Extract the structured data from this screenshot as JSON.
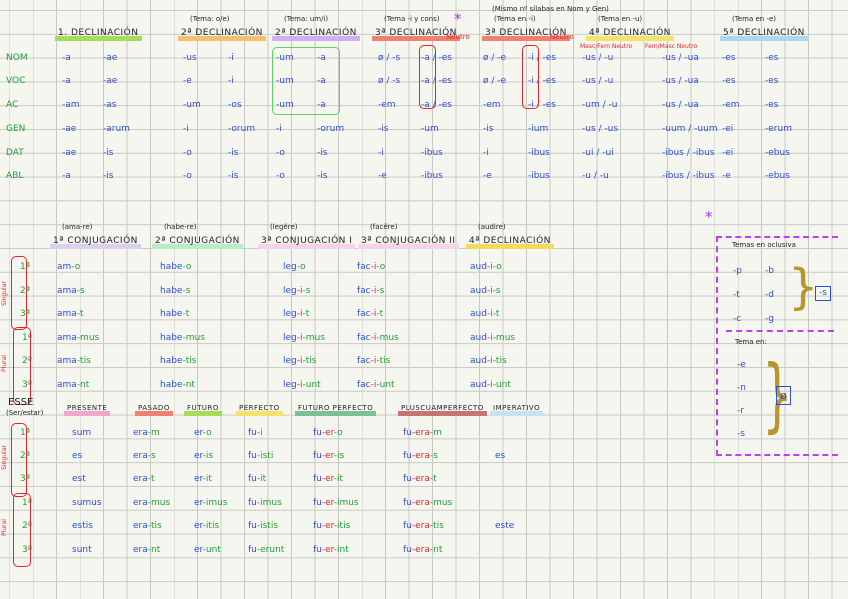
{
  "declensions": {
    "cases": [
      "NOM",
      "VOC",
      "AC",
      "GEN",
      "DAT",
      "ABL"
    ],
    "groups": [
      {
        "note": "",
        "title": "1. Declinación",
        "color": "#a5dc5a",
        "forms": [
          [
            "-a",
            "-ae"
          ],
          [
            "-a",
            "-ae"
          ],
          [
            "-am",
            "-as"
          ],
          [
            "-ae",
            "-arum"
          ],
          [
            "-ae",
            "-is"
          ],
          [
            "-a",
            "-is"
          ]
        ]
      },
      {
        "note": "(Tema: o/e)",
        "title": "2ª Declinación",
        "color": "#f5bf70",
        "forms": [
          [
            "-us",
            "-i"
          ],
          [
            "-e",
            "-i"
          ],
          [
            "-um",
            "-os"
          ],
          [
            "-i",
            "-orum"
          ],
          [
            "-o",
            "-is"
          ],
          [
            "-o",
            "-is"
          ]
        ]
      },
      {
        "note": "(Tema: um/i)",
        "title": "2ª Declinación",
        "color": "#cfaef2",
        "forms": [
          [
            "-um",
            "-a"
          ],
          [
            "-um",
            "-a"
          ],
          [
            "-um",
            "-a"
          ],
          [
            "-i",
            "-orum"
          ],
          [
            "-o",
            "-is"
          ],
          [
            "-o",
            "-is"
          ]
        ]
      },
      {
        "note": "(Tema -i y cons)",
        "title": "3ª Declinación",
        "color": "#ef8170",
        "forms": [
          [
            "ø / -s",
            "-a / -es"
          ],
          [
            "ø / -s",
            "-a / -es"
          ],
          [
            "-em",
            "-a / -es"
          ],
          [
            "-is",
            "-um"
          ],
          [
            "-i",
            "-ibus"
          ],
          [
            "-e",
            "-ibus"
          ]
        ]
      },
      {
        "note": "(Tema en -i)",
        "title": "3ª Declinación",
        "color": "#ef8170",
        "forms": [
          [
            "ø / -e",
            "-i / -es"
          ],
          [
            "ø / -e",
            "-i / -es"
          ],
          [
            "-em",
            "-i / -es"
          ],
          [
            "-is",
            "-ium"
          ],
          [
            "-i",
            "-ibus"
          ],
          [
            "-e",
            "-ibus"
          ]
        ]
      },
      {
        "note": "(Tema en -u)",
        "title": "4ª Declinación",
        "color": "#f3e36a",
        "forms": [
          [
            "-us / -u",
            "-us / -ua"
          ],
          [
            "-us / -u",
            "-us / -ua"
          ],
          [
            "-um / -u",
            "-us / -ua"
          ],
          [
            "-us / -us",
            "-uum / -uum"
          ],
          [
            "-ui / -ui",
            "-ibus / -ibus"
          ],
          [
            "-u / -u",
            "-ibus / -ibus"
          ]
        ]
      },
      {
        "note": "(Tema en -e)",
        "title": "5ª Declinación",
        "color": "#a9d8f0",
        "forms": [
          [
            "-es",
            "-es"
          ],
          [
            "-es",
            "-es"
          ],
          [
            "-em",
            "-es"
          ],
          [
            "-ei",
            "-erum"
          ],
          [
            "-ei",
            "-ebus"
          ],
          [
            "-e",
            "-ebus"
          ]
        ]
      }
    ],
    "annotations": {
      "neutro": "Neutro",
      "extra_note": "(Mismo nº sílabas en Nom y Gen)",
      "masc_fem_neutro": "Masc/Fem Neutro",
      "fem_masc_neutro": "Fem/Masc Neutro",
      "asterisk": "*"
    }
  },
  "conjugations": {
    "persons": [
      "1ª",
      "2ª",
      "3ª",
      "1ª",
      "2ª",
      "3ª"
    ],
    "singular_label": "Singular",
    "plural_label": "Plural",
    "groups": [
      {
        "note": "(ama-re)",
        "title": "1ª Conjugación",
        "color": "#ddd0ee",
        "forms": [
          [
            "am",
            "",
            "-o"
          ],
          [
            "ama",
            "",
            "-s"
          ],
          [
            "ama",
            "",
            "-t"
          ],
          [
            "ama",
            "",
            "-mus"
          ],
          [
            "ama",
            "",
            "-tis"
          ],
          [
            "ama",
            "",
            "-nt"
          ]
        ]
      },
      {
        "note": "(habe-re)",
        "title": "2ª Conjugación",
        "color": "#b8ebc8",
        "forms": [
          [
            "habe",
            "",
            "-o"
          ],
          [
            "habe",
            "",
            "-s"
          ],
          [
            "habe",
            "",
            "-t"
          ],
          [
            "habe",
            "",
            "-mus"
          ],
          [
            "habe",
            "",
            "-tis"
          ],
          [
            "habe",
            "",
            "-nt"
          ]
        ]
      },
      {
        "note": "(legĕre)",
        "title": "3ª Conjugación I",
        "color": "#f6d3e6",
        "forms": [
          [
            "leg",
            "",
            "-o"
          ],
          [
            "leg",
            "-i",
            "-s"
          ],
          [
            "leg",
            "-i",
            "-t"
          ],
          [
            "leg",
            "-i",
            "-mus"
          ],
          [
            "leg",
            "-i",
            "-tis"
          ],
          [
            "leg",
            "-i",
            "-unt"
          ]
        ]
      },
      {
        "note": "(facĕre)",
        "title": "3ª Conjugación II",
        "color": "#f6d3e6",
        "forms": [
          [
            "fac",
            "-i",
            "-o"
          ],
          [
            "fac",
            "-i",
            "-s"
          ],
          [
            "fac",
            "-i",
            "-t"
          ],
          [
            "fac",
            "-i",
            "-mus"
          ],
          [
            "fac",
            "-i",
            "-tis"
          ],
          [
            "fac",
            "-i",
            "-unt"
          ]
        ]
      },
      {
        "note": "(audire)",
        "title": "4ª Declinación",
        "color": "#f3db5a",
        "forms": [
          [
            "aud",
            "-i",
            "-o"
          ],
          [
            "aud",
            "-i",
            "-s"
          ],
          [
            "aud",
            "-i",
            "-t"
          ],
          [
            "aud",
            "-i",
            "-mus"
          ],
          [
            "aud",
            "-i",
            "-tis"
          ],
          [
            "aud",
            "-i",
            "-unt"
          ]
        ]
      }
    ]
  },
  "esse": {
    "title": "ESSE",
    "subtitle": "(Ser/estar)",
    "tenses": [
      {
        "title": "Presente",
        "color": "#f0a6cf",
        "forms": [
          [
            "sum",
            "",
            ""
          ],
          [
            "es",
            "",
            ""
          ],
          [
            "est",
            "",
            ""
          ],
          [
            "sumus",
            "",
            ""
          ],
          [
            "estis",
            "",
            ""
          ],
          [
            "sunt",
            "",
            ""
          ]
        ]
      },
      {
        "title": "Pasado",
        "color": "#ef8170",
        "forms": [
          [
            "era",
            "",
            "-m"
          ],
          [
            "era",
            "",
            "-s"
          ],
          [
            "era",
            "",
            "-t"
          ],
          [
            "era",
            "",
            "-mus"
          ],
          [
            "era",
            "",
            "-tis"
          ],
          [
            "era",
            "",
            "-nt"
          ]
        ]
      },
      {
        "title": "Futuro",
        "color": "#a5dc5a",
        "forms": [
          [
            "er",
            "",
            "-o"
          ],
          [
            "er",
            "",
            "-is"
          ],
          [
            "er",
            "",
            "-it"
          ],
          [
            "er",
            "",
            "-imus"
          ],
          [
            "er",
            "",
            "-itis"
          ],
          [
            "er",
            "",
            "-unt"
          ]
        ]
      },
      {
        "title": "Perfecto",
        "color": "#f3e36a",
        "forms": [
          [
            "fu",
            "",
            "-i"
          ],
          [
            "fu",
            "",
            "-isti"
          ],
          [
            "fu",
            "",
            "-it"
          ],
          [
            "fu",
            "",
            "-imus"
          ],
          [
            "fu",
            "",
            "-istis"
          ],
          [
            "fu",
            "",
            "-erunt"
          ]
        ]
      },
      {
        "title": "Futuro perfecto",
        "color": "#7fbf95",
        "forms": [
          [
            "fu",
            "-er",
            "-o"
          ],
          [
            "fu",
            "-er",
            "-is"
          ],
          [
            "fu",
            "-er",
            "-it"
          ],
          [
            "fu",
            "-er",
            "-imus"
          ],
          [
            "fu",
            "-er",
            "-itis"
          ],
          [
            "fu",
            "-er",
            "-int"
          ]
        ]
      },
      {
        "title": "Pluscuamperfecto",
        "color": "#c77474",
        "forms": [
          [
            "fu",
            "-era",
            "-m"
          ],
          [
            "fu",
            "-era",
            "-s"
          ],
          [
            "fu",
            "-era",
            "-t"
          ],
          [
            "fu",
            "-era",
            "-mus"
          ],
          [
            "fu",
            "-era",
            "-tis"
          ],
          [
            "fu",
            "-era",
            "-nt"
          ]
        ]
      },
      {
        "title": "Imperativo",
        "color": "#c6e2f0",
        "forms": [
          [
            "",
            "",
            ""
          ],
          [
            "es",
            "",
            ""
          ],
          [
            "",
            "",
            ""
          ],
          [
            "",
            "",
            ""
          ],
          [
            "este",
            "",
            ""
          ],
          [
            "",
            "",
            ""
          ]
        ]
      }
    ]
  },
  "stems_box": {
    "asterisk": "*",
    "title1": "Temas en oclusiva",
    "pairs": [
      [
        "-p",
        "-b"
      ],
      [
        "-t",
        "-d"
      ],
      [
        "-c",
        "-g"
      ]
    ],
    "result1": "-s",
    "title2": "Tema en:",
    "items": [
      "-e",
      "-n",
      "-r",
      "-s"
    ],
    "result2": "ø"
  }
}
